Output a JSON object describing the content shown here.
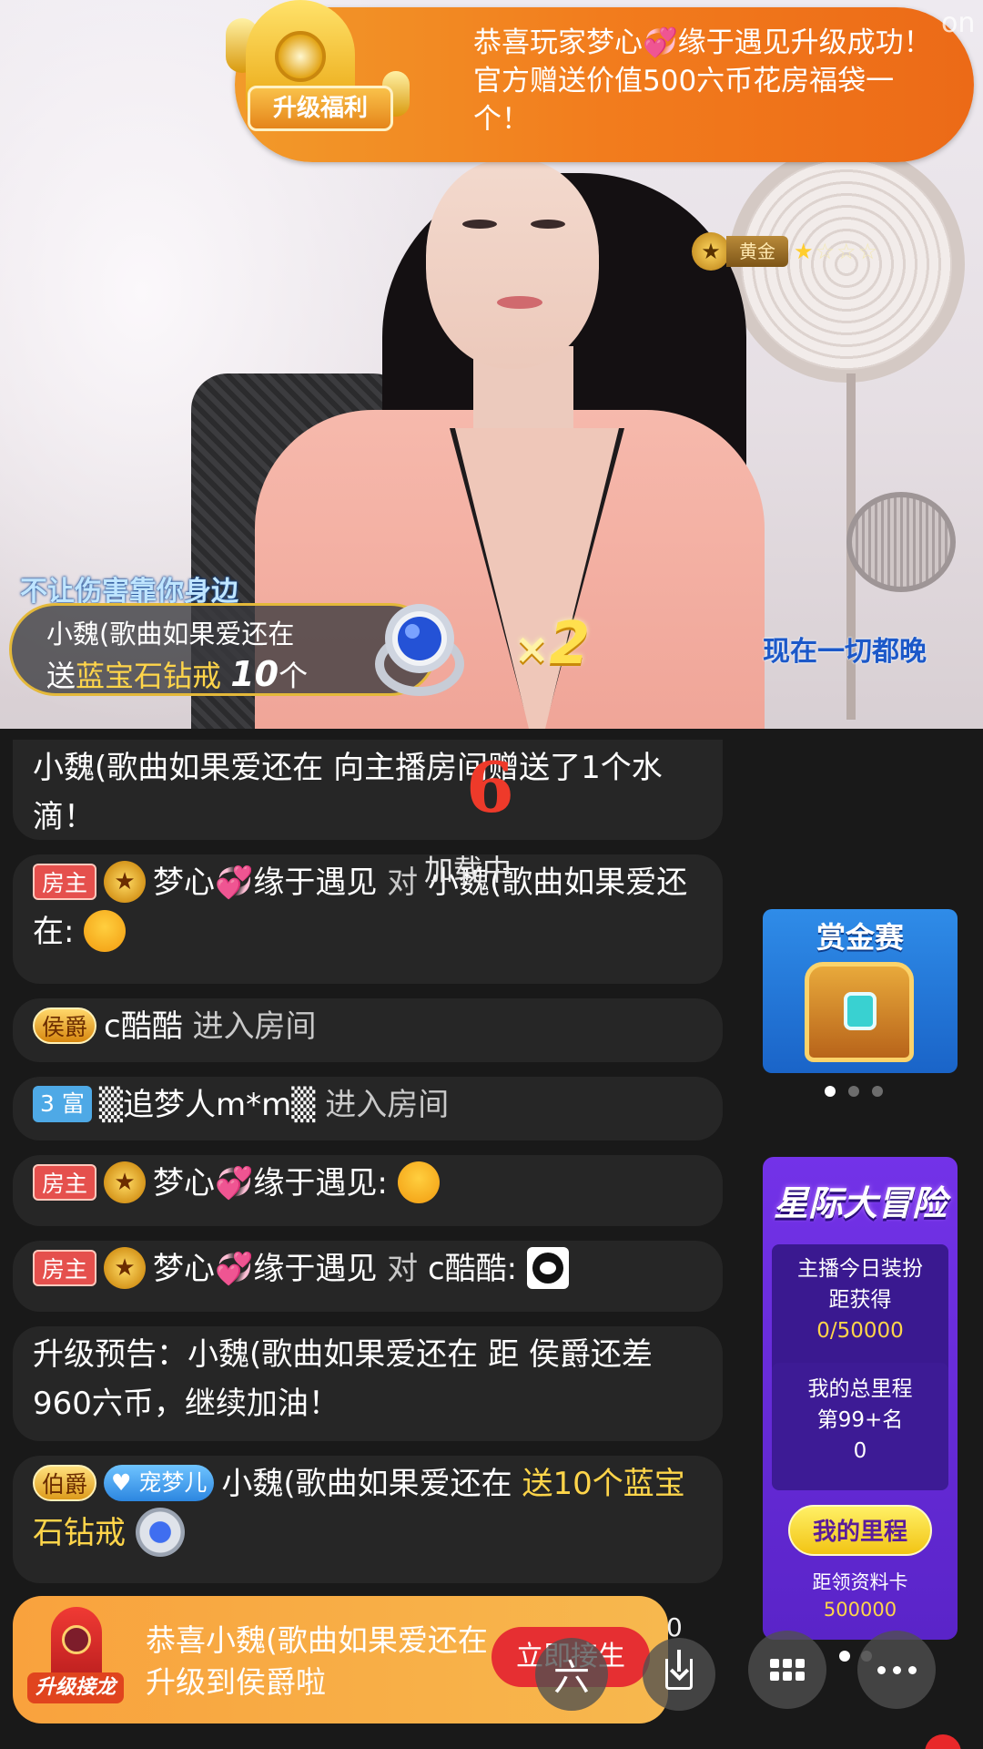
{
  "banner": {
    "label": "升级福利",
    "text_pre": "恭喜玩家梦心",
    "heart": "💞",
    "text_post": "缘于遇见升级成功！官方赠送价值500六币花房福袋一个！",
    "watermark": "on"
  },
  "anchor_level": {
    "name": "黄金",
    "stars_filled": "★",
    "stars_empty": "☆☆☆",
    "medal_icon": "★"
  },
  "lyrics": {
    "left": "不让伤害靠你身边",
    "right": "现在一切都晚"
  },
  "gift": {
    "line1": "小魏(歌曲如果爱还在",
    "send": "送",
    "item": "蓝宝石钻戒",
    "count": "10",
    "unit": "个",
    "multiplier_x": "×",
    "multiplier_n": "2"
  },
  "loading": {
    "logo": "6",
    "text": "加载中"
  },
  "chat": {
    "m0": {
      "text": "小魏(歌曲如果爱还在 向主播房间赠送了1个水滴！"
    },
    "m1": {
      "tag": "房主",
      "medal": "★",
      "user": "梦心",
      "heart": "💞",
      "user2": "缘于遇见",
      "verb": "对",
      "target": "小魏(歌曲如果爱还在:"
    },
    "m2": {
      "tag": "侯爵",
      "user": "c酷酷",
      "action": "进入房间"
    },
    "m3": {
      "tag": "3 富",
      "user": "▒追梦人m*m▒",
      "action": "进入房间"
    },
    "m4": {
      "tag": "房主",
      "medal": "★",
      "user": "梦心",
      "heart": "💞",
      "user2": "缘于遇见:"
    },
    "m5": {
      "tag": "房主",
      "medal": "★",
      "user": "梦心",
      "heart": "💞",
      "user2": "缘于遇见",
      "verb": "对",
      "target": "c酷酷:"
    },
    "m6": {
      "text": "升级预告：小魏(歌曲如果爱还在 距 侯爵还差960六币，继续加油！"
    },
    "m7": {
      "tag": "伯爵",
      "fan_tag": "宠梦儿",
      "user": "小魏(歌曲如果爱还在",
      "gift": "送10个蓝宝石钻戒"
    }
  },
  "bounty": {
    "title": "赏金赛"
  },
  "adventure": {
    "title": "星际大冒险",
    "p1_line1": "主播今日装扮",
    "p1_line2": "距获得",
    "p1_value": "0/50000",
    "p2_line1": "我的总里程",
    "p2_rank": "第99+名",
    "p2_value": "0",
    "button": "我的里程",
    "foot_line1": "距领资料卡",
    "foot_value": "500000"
  },
  "relay": {
    "label": "升级接龙",
    "text": "恭喜小魏(歌曲如果爱还在升级到侯爵啦",
    "button": "立即接生",
    "peek": "0"
  },
  "toolbar": {
    "six_icon": "六"
  }
}
